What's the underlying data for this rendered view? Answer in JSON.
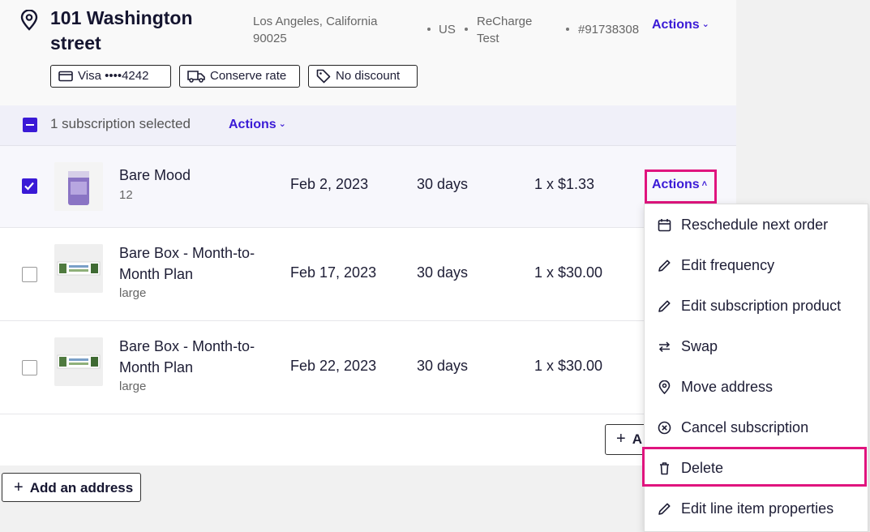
{
  "address": {
    "title": "101 Washington street",
    "city": "Los Angeles, California 90025",
    "country": "US",
    "store": "ReCharge Test",
    "id": "#91738308",
    "actions_label": "Actions",
    "chips": [
      {
        "icon": "credit-card-icon",
        "label": "Visa ••••4242"
      },
      {
        "icon": "truck-icon",
        "label": "Conserve rate"
      },
      {
        "icon": "tag-icon",
        "label": "No discount"
      }
    ]
  },
  "bulk": {
    "label": "1 subscription selected",
    "actions_label": "Actions",
    "state": "indeterminate"
  },
  "subscriptions": [
    {
      "name": "Bare Mood",
      "variant": "12",
      "date": "Feb 2, 2023",
      "frequency": "30 days",
      "price": "1 x $1.33",
      "checked": true,
      "actions_label": "Actions",
      "thumb": "purple-canister"
    },
    {
      "name": "Bare Box - Month-to-Month Plan",
      "variant": "large",
      "date": "Feb 17, 2023",
      "frequency": "30 days",
      "price": "1 x $30.00",
      "checked": false,
      "thumb": "bare-box-banner"
    },
    {
      "name": "Bare Box - Month-to-Month Plan",
      "variant": "large",
      "date": "Feb 22, 2023",
      "frequency": "30 days",
      "price": "1 x $30.00",
      "checked": false,
      "thumb": "bare-box-banner"
    }
  ],
  "add_subscription_label": "A",
  "add_address_label": "Add an address",
  "menu": {
    "items": [
      {
        "icon": "calendar-icon",
        "label": "Reschedule next order"
      },
      {
        "icon": "pencil-icon",
        "label": "Edit frequency"
      },
      {
        "icon": "pencil-icon",
        "label": "Edit subscription product"
      },
      {
        "icon": "swap-icon",
        "label": "Swap"
      },
      {
        "icon": "map-pin-icon",
        "label": "Move address"
      },
      {
        "icon": "cancel-circle-icon",
        "label": "Cancel subscription"
      },
      {
        "icon": "trash-icon",
        "label": "Delete",
        "highlighted": true
      },
      {
        "icon": "pencil-icon",
        "label": "Edit line item properties"
      }
    ]
  },
  "colors": {
    "accent": "#3a1ad6",
    "highlight": "#e0147e"
  }
}
